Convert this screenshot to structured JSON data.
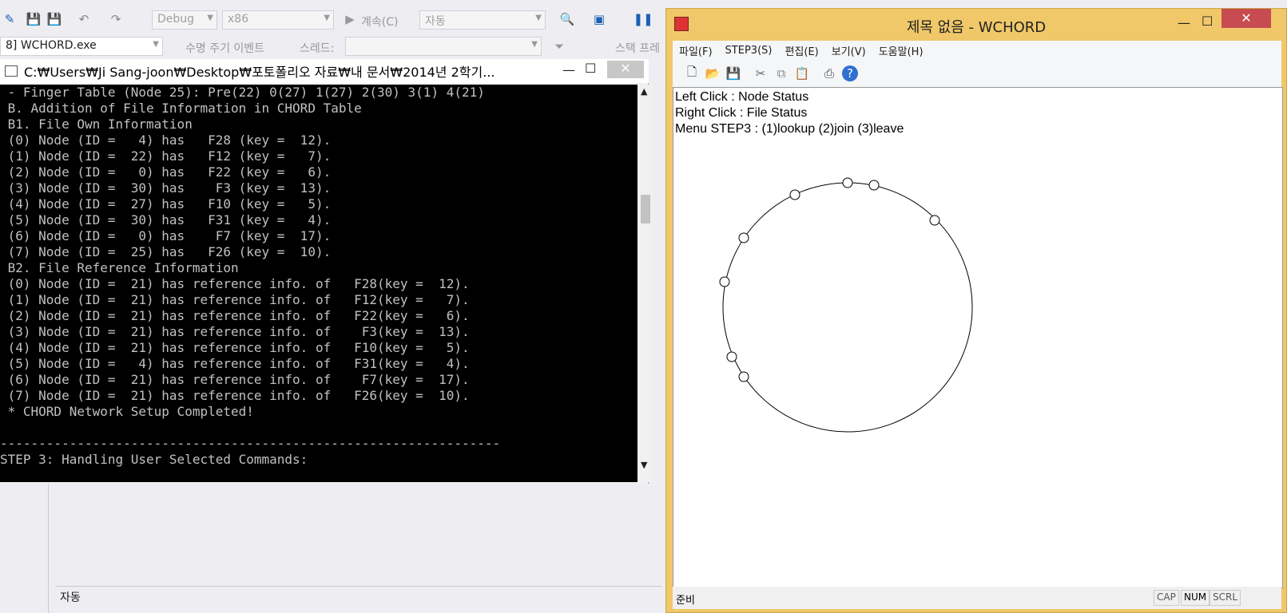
{
  "vs": {
    "config_combo": "Debug",
    "platform_combo": "x86",
    "continue_label": "계속(C)",
    "auto_combo": "자동",
    "process_combo": "8] WCHORD.exe",
    "lifecycle_label": "수명 주기 이벤트",
    "thread_label": "스레드:",
    "stackframe_label": "스택 프레",
    "bottom_panel_title": "자동"
  },
  "console": {
    "title": "C:₩Users₩Ji Sang-joon₩Desktop₩포토폴리오 자료₩내 문서₩2014년 2학기...",
    "lines": [
      " - Finger Table (Node 25): Pre(22) 0(27) 1(27) 2(30) 3(1) 4(21)",
      " B. Addition of File Information in CHORD Table",
      " B1. File Own Information",
      " (0) Node (ID =   4) has   F28 (key =  12).",
      " (1) Node (ID =  22) has   F12 (key =   7).",
      " (2) Node (ID =   0) has   F22 (key =   6).",
      " (3) Node (ID =  30) has    F3 (key =  13).",
      " (4) Node (ID =  27) has   F10 (key =   5).",
      " (5) Node (ID =  30) has   F31 (key =   4).",
      " (6) Node (ID =   0) has    F7 (key =  17).",
      " (7) Node (ID =  25) has   F26 (key =  10).",
      " B2. File Reference Information",
      " (0) Node (ID =  21) has reference info. of   F28(key =  12).",
      " (1) Node (ID =  21) has reference info. of   F12(key =   7).",
      " (2) Node (ID =  21) has reference info. of   F22(key =   6).",
      " (3) Node (ID =  21) has reference info. of    F3(key =  13).",
      " (4) Node (ID =  21) has reference info. of   F10(key =   5).",
      " (5) Node (ID =   4) has reference info. of   F31(key =   4).",
      " (6) Node (ID =  21) has reference info. of    F7(key =  17).",
      " (7) Node (ID =  21) has reference info. of   F26(key =  10).",
      " * CHORD Network Setup Completed!",
      "",
      "-----------------------------------------------------------------",
      "STEP 3: Handling User Selected Commands:"
    ]
  },
  "wchord": {
    "title": "제목 없음 - WCHORD",
    "menu": [
      "파일(F)",
      "STEP3(S)",
      "편집(E)",
      "보기(V)",
      "도움말(H)"
    ],
    "help_lines": [
      "Left Click : Node Status",
      "Right Click : File Status",
      "Menu STEP3 : (1)lookup (2)join (3)leave"
    ],
    "status_left": "준비",
    "status_cap": "CAP",
    "status_num": "NUM",
    "status_scrl": "SCRL"
  }
}
